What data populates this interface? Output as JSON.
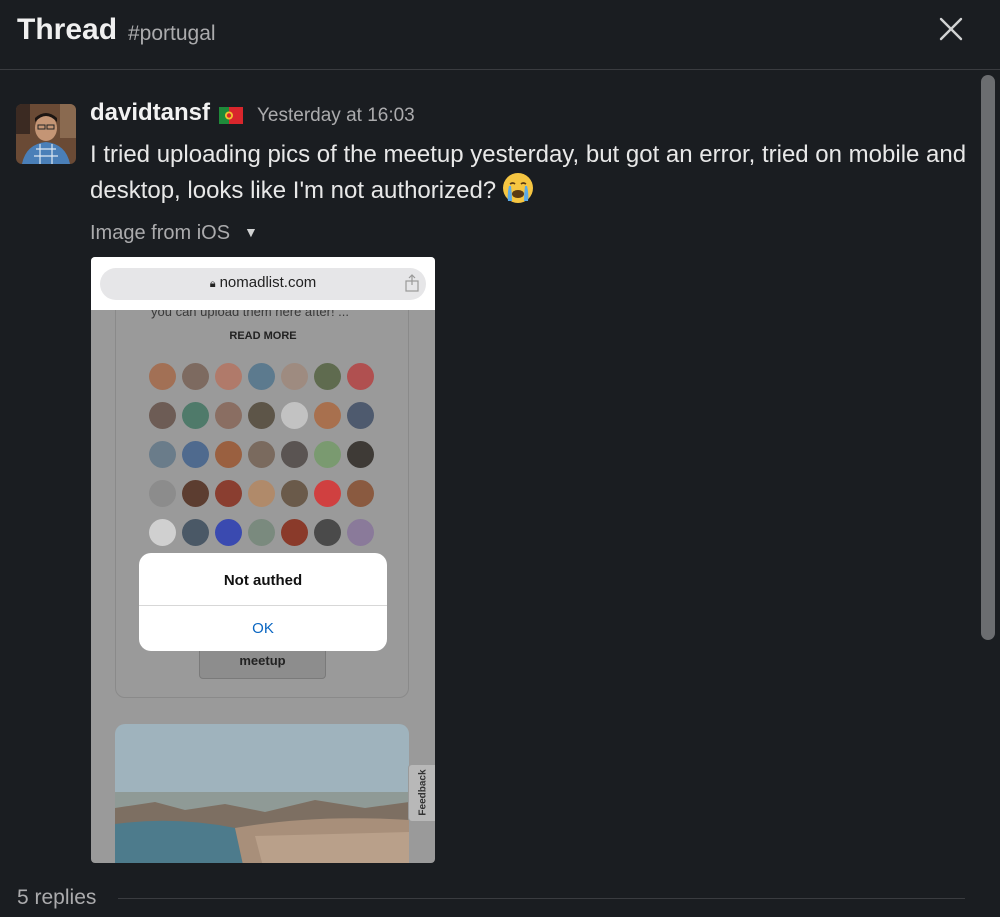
{
  "header": {
    "title": "Thread",
    "channel": "#portugal",
    "close_icon": "close-icon"
  },
  "message": {
    "author": "davidtansf",
    "flag": "portugal-flag-emoji",
    "timestamp": "Yesterday at 16:03",
    "text": "I tried uploading pics of the meetup yesterday, but got an error, tried on mobile and desktop, looks like I'm not authorized?",
    "emoji": "crying-face-emoji",
    "attachment_label": "Image from iOS"
  },
  "screenshot": {
    "url": "nomadlist.com",
    "card_text": "you can upload them here after! ...",
    "read_more": "READ MORE",
    "meetup_button": "meetup",
    "dialog_title": "Not authed",
    "dialog_ok": "OK",
    "feedback": "Feedback"
  },
  "footer": {
    "replies": "5 replies"
  },
  "colors": {
    "background": "#1a1d21",
    "text": "#d1d2d3",
    "link_blue": "#0a66c2"
  }
}
